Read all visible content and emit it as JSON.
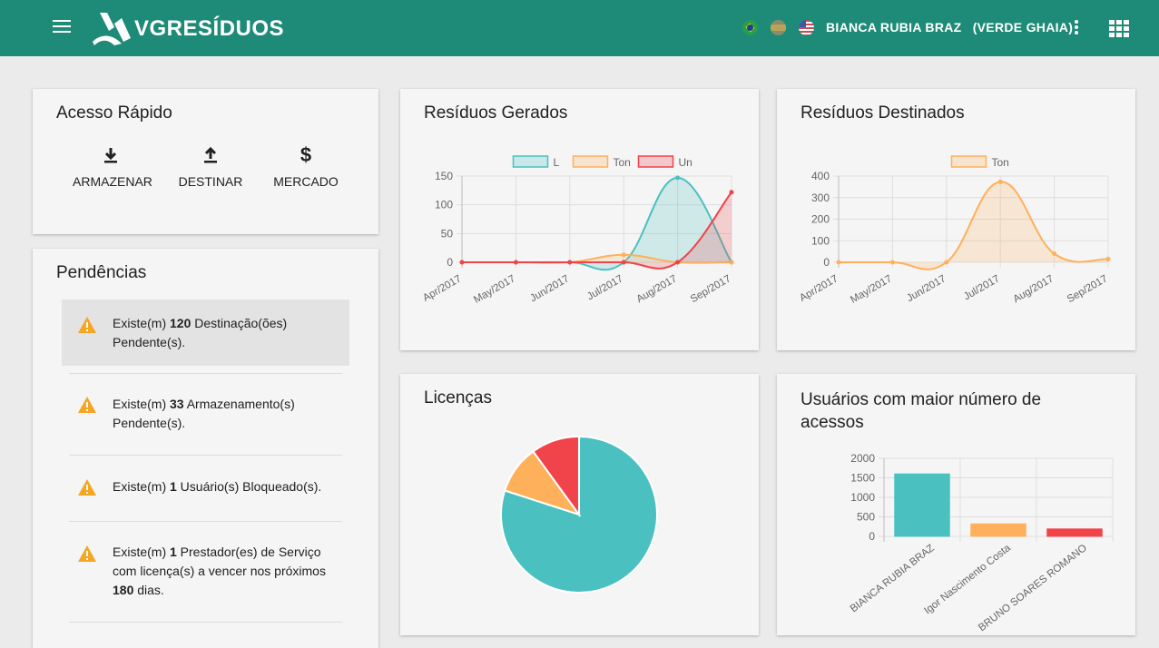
{
  "header": {
    "logo_text": "VGRESÍDUOS",
    "user_name": "BIANCA RUBIA BRAZ",
    "user_org": "(VERDE GHAIA)",
    "menu_icon": "hamburger-menu-icon",
    "more_icon": "kebab-menu-icon",
    "apps_icon": "apps-grid-icon",
    "flags": [
      "brazil-flag-icon",
      "spain-flag-icon",
      "usa-flag-icon"
    ]
  },
  "quick_access": {
    "title": "Acesso Rápido",
    "buttons": [
      {
        "label": "ARMAZENAR",
        "icon": "download-icon"
      },
      {
        "label": "DESTINAR",
        "icon": "upload-icon"
      },
      {
        "label": "MERCADO",
        "icon": "dollar-icon"
      }
    ]
  },
  "pendencias": {
    "title": "Pendências",
    "items": [
      {
        "prefix": "Existe(m) ",
        "count": "120",
        "suffix": " Destinação(ões) Pendente(s).",
        "extra": "",
        "extra2": ""
      },
      {
        "prefix": "Existe(m) ",
        "count": "33",
        "suffix": " Armazenamento(s) Pendente(s).",
        "extra": "",
        "extra2": ""
      },
      {
        "prefix": "Existe(m) ",
        "count": "1",
        "suffix": " Usuário(s) Bloqueado(s).",
        "extra": "",
        "extra2": ""
      },
      {
        "prefix": "Existe(m) ",
        "count": "1",
        "suffix": " Prestador(es) de Serviço com licença(s) a vencer nos próximos ",
        "extra": "180",
        "extra2": " dias."
      }
    ]
  },
  "residuos_gerados": {
    "title": "Resíduos Gerados"
  },
  "residuos_destinados": {
    "title": "Resíduos Destinados"
  },
  "licencas": {
    "title": "Licenças"
  },
  "usuarios": {
    "title": "Usuários com maior número de acessos"
  },
  "chart_data": [
    {
      "id": "residuos-gerados",
      "type": "line",
      "x": [
        "Apr/2017",
        "May/2017",
        "Jun/2017",
        "Jul/2017",
        "Aug/2017",
        "Sep/2017"
      ],
      "ylim": [
        0,
        150
      ],
      "yticks": [
        0,
        50,
        100,
        150
      ],
      "grid": true,
      "legend": "top",
      "series": [
        {
          "name": "L",
          "values": [
            0,
            0,
            0,
            0,
            147,
            0
          ],
          "color": "#4bc0c0"
        },
        {
          "name": "Ton",
          "values": [
            0,
            0,
            0,
            13,
            0,
            0
          ],
          "color": "#ffb05a"
        },
        {
          "name": "Un",
          "values": [
            0,
            0,
            0,
            0,
            0,
            122
          ],
          "color": "#f0434a"
        }
      ]
    },
    {
      "id": "residuos-destinados",
      "type": "line",
      "x": [
        "Apr/2017",
        "May/2017",
        "Jun/2017",
        "Jul/2017",
        "Aug/2017",
        "Sep/2017"
      ],
      "ylim": [
        0,
        400
      ],
      "yticks": [
        0,
        100,
        200,
        300,
        400
      ],
      "grid": true,
      "legend": "top",
      "series": [
        {
          "name": "Ton",
          "values": [
            0,
            0,
            0,
            373,
            40,
            15
          ],
          "color": "#ffb05a"
        }
      ]
    },
    {
      "id": "licencas",
      "type": "pie",
      "values": [
        80,
        10,
        10
      ],
      "colors": [
        "#4bc0c0",
        "#ffb05a",
        "#f0434a"
      ]
    },
    {
      "id": "usuarios-acessos",
      "type": "bar",
      "categories": [
        "BIANCA RUBIA BRAZ",
        "Igor Nascimento Costa",
        "BRUNO SOARES ROMANO"
      ],
      "values": [
        1600,
        320,
        190
      ],
      "colors": [
        "#4bc0c0",
        "#ffb05a",
        "#f0434a"
      ],
      "ylim": [
        0,
        2000
      ],
      "yticks": [
        0,
        500,
        1000,
        1500,
        2000
      ],
      "grid": true
    }
  ]
}
